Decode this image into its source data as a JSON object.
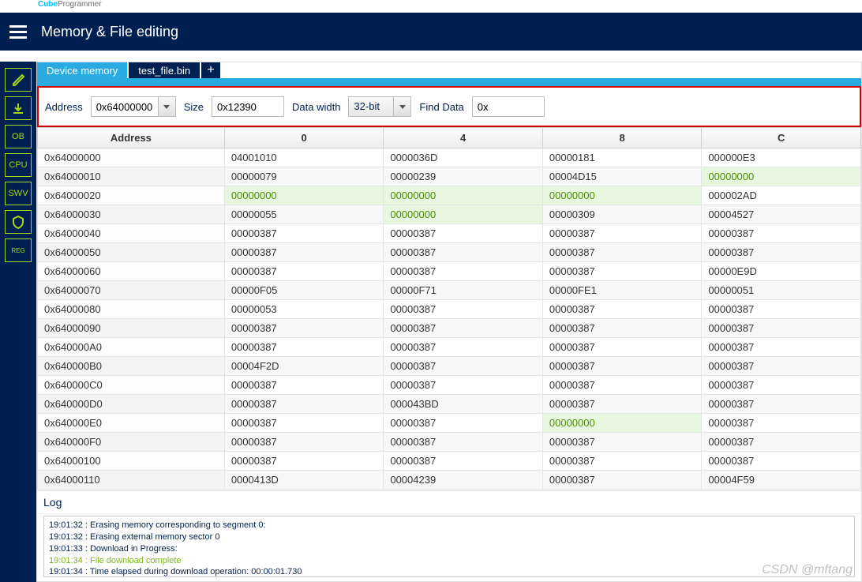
{
  "logo": {
    "cube": "Cube",
    "prog": "Programmer"
  },
  "header": {
    "title": "Memory & File editing"
  },
  "sidebar": {
    "items": [
      {
        "name": "edit",
        "text": ""
      },
      {
        "name": "download",
        "text": ""
      },
      {
        "name": "ob",
        "text": "OB"
      },
      {
        "name": "cpu",
        "text": "CPU"
      },
      {
        "name": "swv",
        "text": "SWV"
      },
      {
        "name": "secure",
        "text": ""
      },
      {
        "name": "reg",
        "text": "REG"
      }
    ]
  },
  "tabs": {
    "active": "Device memory",
    "file": "test_file.bin",
    "plus": "+"
  },
  "toolbar": {
    "address_label": "Address",
    "address_value": "0x64000000",
    "size_label": "Size",
    "size_value": "0x12390",
    "datawidth_label": "Data width",
    "datawidth_value": "32-bit",
    "find_label": "Find Data",
    "find_value": "0x"
  },
  "grid": {
    "headers": [
      "Address",
      "0",
      "4",
      "8",
      "C"
    ],
    "rows": [
      {
        "addr": "0x64000000",
        "c0": "04001010",
        "c4": "0000036D",
        "c8": "00000181",
        "cC": "000000E3"
      },
      {
        "addr": "0x64000010",
        "c0": "00000079",
        "c4": "00000239",
        "c8": "00004D15",
        "cC": "00000000"
      },
      {
        "addr": "0x64000020",
        "c0": "00000000",
        "c4": "00000000",
        "c8": "00000000",
        "cC": "000002AD"
      },
      {
        "addr": "0x64000030",
        "c0": "00000055",
        "c4": "00000000",
        "c8": "00000309",
        "cC": "00004527"
      },
      {
        "addr": "0x64000040",
        "c0": "00000387",
        "c4": "00000387",
        "c8": "00000387",
        "cC": "00000387"
      },
      {
        "addr": "0x64000050",
        "c0": "00000387",
        "c4": "00000387",
        "c8": "00000387",
        "cC": "00000387"
      },
      {
        "addr": "0x64000060",
        "c0": "00000387",
        "c4": "00000387",
        "c8": "00000387",
        "cC": "00000E9D"
      },
      {
        "addr": "0x64000070",
        "c0": "00000F05",
        "c4": "00000F71",
        "c8": "00000FE1",
        "cC": "00000051"
      },
      {
        "addr": "0x64000080",
        "c0": "00000053",
        "c4": "00000387",
        "c8": "00000387",
        "cC": "00000387"
      },
      {
        "addr": "0x64000090",
        "c0": "00000387",
        "c4": "00000387",
        "c8": "00000387",
        "cC": "00000387"
      },
      {
        "addr": "0x640000A0",
        "c0": "00000387",
        "c4": "00000387",
        "c8": "00000387",
        "cC": "00000387"
      },
      {
        "addr": "0x640000B0",
        "c0": "00004F2D",
        "c4": "00000387",
        "c8": "00000387",
        "cC": "00000387"
      },
      {
        "addr": "0x640000C0",
        "c0": "00000387",
        "c4": "00000387",
        "c8": "00000387",
        "cC": "00000387"
      },
      {
        "addr": "0x640000D0",
        "c0": "00000387",
        "c4": "000043BD",
        "c8": "00000387",
        "cC": "00000387"
      },
      {
        "addr": "0x640000E0",
        "c0": "00000387",
        "c4": "00000387",
        "c8": "00000000",
        "cC": "00000387"
      },
      {
        "addr": "0x640000F0",
        "c0": "00000387",
        "c4": "00000387",
        "c8": "00000387",
        "cC": "00000387"
      },
      {
        "addr": "0x64000100",
        "c0": "00000387",
        "c4": "00000387",
        "c8": "00000387",
        "cC": "00000387"
      },
      {
        "addr": "0x64000110",
        "c0": "0000413D",
        "c4": "00004239",
        "c8": "00000387",
        "cC": "00004F59"
      }
    ]
  },
  "log": {
    "title": "Log",
    "lines": [
      {
        "text": "19:01:32 : Erasing memory corresponding to segment 0:",
        "cls": ""
      },
      {
        "text": "19:01:32 : Erasing external memory sector 0",
        "cls": ""
      },
      {
        "text": "19:01:33 : Download in Progress:",
        "cls": ""
      },
      {
        "text": "19:01:34 : File download complete",
        "cls": "ok"
      },
      {
        "text": "19:01:34 : Time elapsed during download operation: 00:00:01.730",
        "cls": ""
      }
    ]
  },
  "watermark": "CSDN @mftang"
}
